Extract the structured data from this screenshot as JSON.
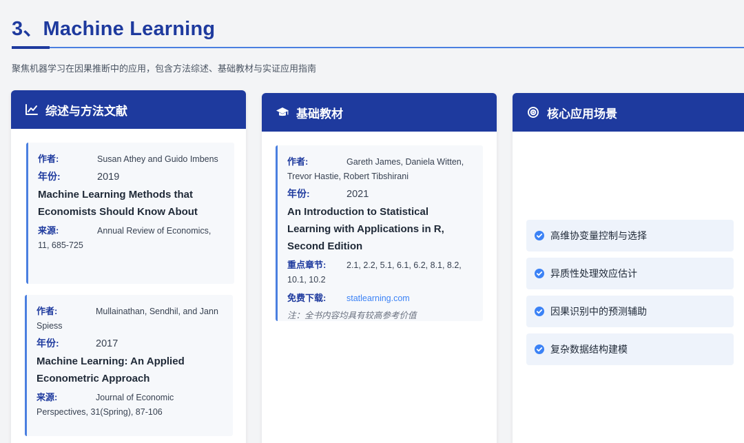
{
  "page": {
    "title": "3、Machine Learning",
    "subtitle": "聚焦机器学习在因果推断中的应用，包含方法综述、基础教材与实证应用指南"
  },
  "cards": [
    {
      "header": "综述与方法文献",
      "icon": "chart-line-icon",
      "entries": [
        {
          "author_label": "作者:",
          "author": "Susan Athey and Guido Imbens",
          "year_label": "年份:",
          "year": "2019",
          "title": "Machine Learning Methods that Economists Should Know About",
          "source_label": "来源:",
          "source": "Annual Review of Economics, 11, 685-725"
        },
        {
          "author_label": "作者:",
          "author": "Mullainathan, Sendhil, and Jann Spiess",
          "year_label": "年份:",
          "year": "2017",
          "title": "Machine Learning: An Applied Econometric Approach",
          "source_label": "来源:",
          "source": "Journal of Economic Perspectives, 31(Spring), 87-106"
        }
      ]
    },
    {
      "header": "基础教材",
      "icon": "graduation-cap-icon",
      "entries": [
        {
          "author_label": "作者:",
          "author": "Gareth James, Daniela Witten, Trevor Hastie, Robert Tibshirani",
          "year_label": "年份:",
          "year": "2021",
          "title": "An Introduction to Statistical Learning with Applications in R, Second Edition",
          "chapters_label": "重点章节:",
          "chapters": "2.1, 2.2, 5.1, 6.1, 6.2, 8.1, 8.2, 10.1, 10.2",
          "download_label": "免费下载:",
          "download": "statlearning.com",
          "note": "注：全书内容均具有较高参考价值"
        }
      ]
    },
    {
      "header": "核心应用场景",
      "icon": "target-icon",
      "items": [
        "高维协变量控制与选择",
        "异质性处理效应估计",
        "因果识别中的预测辅助",
        "复杂数据结构建模"
      ]
    }
  ],
  "colors": {
    "accent": "#1e3a9e",
    "link": "#3b82f6",
    "border": "#4a7fe0"
  }
}
